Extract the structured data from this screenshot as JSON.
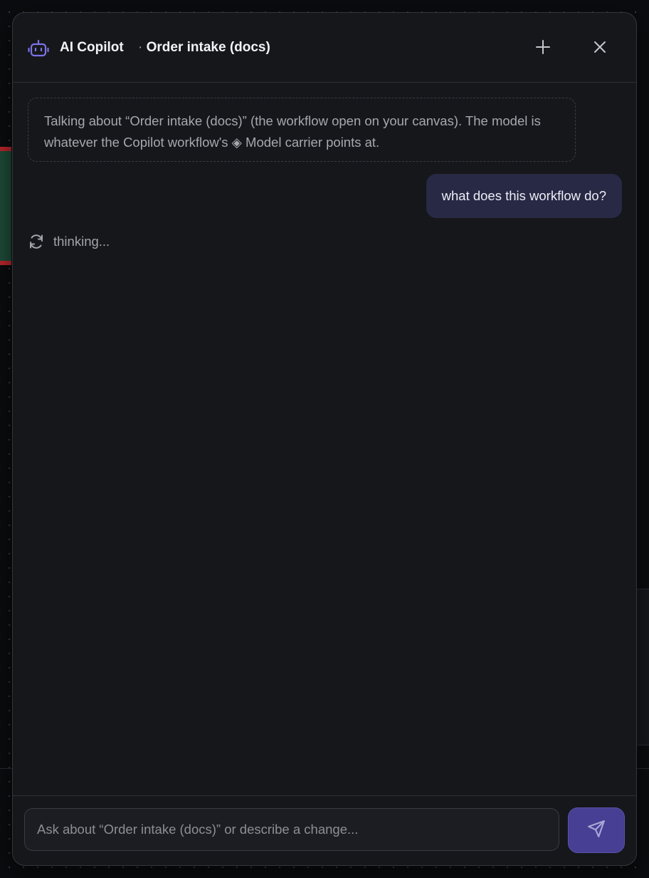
{
  "header": {
    "title": "AI Copilot",
    "subtitle_sep": "·",
    "subtitle": "Order intake (docs)",
    "icons": {
      "app": "robot-icon",
      "new": "plus-icon",
      "close": "close-icon"
    }
  },
  "messages": {
    "context_note": "Talking about “Order intake (docs)” (the workflow open on your canvas). The model is whatever the Copilot workflow's ◈ Model carrier points at.",
    "user_message": "what does this workflow do?",
    "status": "thinking...",
    "status_icon": "refresh-icon"
  },
  "composer": {
    "placeholder": "Ask about “Order intake (docs)” or describe a change...",
    "value": "",
    "send_icon": "send-icon"
  },
  "colors": {
    "accent": "#7b74e6",
    "send_button": "#463f93",
    "user_bubble": "#272945",
    "panel_bg": "#16171b"
  }
}
